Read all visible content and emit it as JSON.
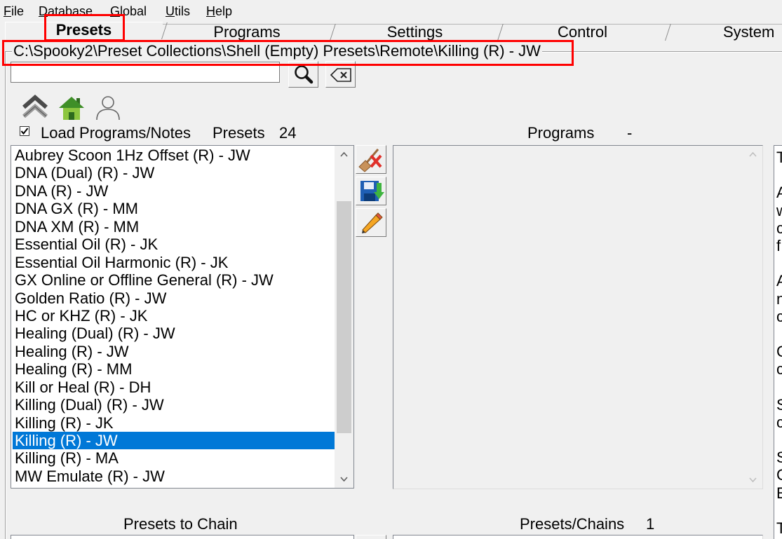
{
  "menu": {
    "items": [
      {
        "label": "File"
      },
      {
        "label": "Database"
      },
      {
        "label": "Global"
      },
      {
        "label": "Utils"
      },
      {
        "label": "Help"
      }
    ]
  },
  "tabs": [
    {
      "label": "Presets",
      "selected": true
    },
    {
      "label": "Programs",
      "selected": false
    },
    {
      "label": "Settings",
      "selected": false
    },
    {
      "label": "Control",
      "selected": false
    },
    {
      "label": "System",
      "selected": false
    }
  ],
  "path_group": {
    "caption": "C:\\Spooky2\\Preset Collections\\Shell (Empty) Presets\\Remote\\Killing (R) - JW"
  },
  "search": {
    "value": "",
    "search_icon": "magnifier-icon",
    "clear_icon": "backspace-clear-icon"
  },
  "nav_buttons": {
    "up_icon": "double-chevron-up-icon",
    "home_icon": "home-icon",
    "user_icon": "user-outline-icon"
  },
  "load_programs": {
    "label": "Load Programs/Notes",
    "checked": true
  },
  "presets": {
    "label": "Presets",
    "count": "24",
    "items": [
      {
        "label": "Aubrey Scoon 1Hz Offset (R) - JW",
        "selected": false
      },
      {
        "label": "DNA (Dual) (R) - JW",
        "selected": false
      },
      {
        "label": "DNA (R) - JW",
        "selected": false
      },
      {
        "label": "DNA GX (R) - MM",
        "selected": false
      },
      {
        "label": "DNA XM (R) - MM",
        "selected": false
      },
      {
        "label": "Essential Oil (R) - JK",
        "selected": false
      },
      {
        "label": "Essential Oil Harmonic (R) - JK",
        "selected": false
      },
      {
        "label": "GX Online or Offline General (R) - JW",
        "selected": false
      },
      {
        "label": "Golden Ratio (R) - JW",
        "selected": false
      },
      {
        "label": "HC or KHZ (R) - JK",
        "selected": false
      },
      {
        "label": "Healing (Dual) (R) - JW",
        "selected": false
      },
      {
        "label": "Healing (R) - JW",
        "selected": false
      },
      {
        "label": "Healing (R) - MM",
        "selected": false
      },
      {
        "label": "Kill or Heal (R) - DH",
        "selected": false
      },
      {
        "label": "Killing (Dual) (R) - JW",
        "selected": false
      },
      {
        "label": "Killing (R) - JK",
        "selected": false
      },
      {
        "label": "Killing (R) - JW",
        "selected": true
      },
      {
        "label": "Killing (R) - MA",
        "selected": false
      },
      {
        "label": "MW Emulate (R) - JW",
        "selected": false
      }
    ]
  },
  "preset_actions": {
    "delete_icon": "broom-delete-icon",
    "save_icon": "floppy-save-icon",
    "edit_icon": "pencil-edit-icon"
  },
  "programs": {
    "label": "Programs",
    "count": "-",
    "items": []
  },
  "notes": {
    "visible_lines": [
      "T",
      "",
      "A",
      "w",
      "c",
      "f",
      "",
      "A",
      "n",
      "c",
      "",
      "C",
      "c",
      "",
      "S",
      "c",
      "",
      "S",
      "C",
      "E",
      "",
      "T"
    ]
  },
  "chain": {
    "label": "Presets to Chain"
  },
  "presets_chains": {
    "label": "Presets/Chains",
    "count": "1"
  },
  "colors": {
    "selection": "#0078d7",
    "annotation": "#ff0000",
    "window_bg": "#f0f0f0"
  }
}
